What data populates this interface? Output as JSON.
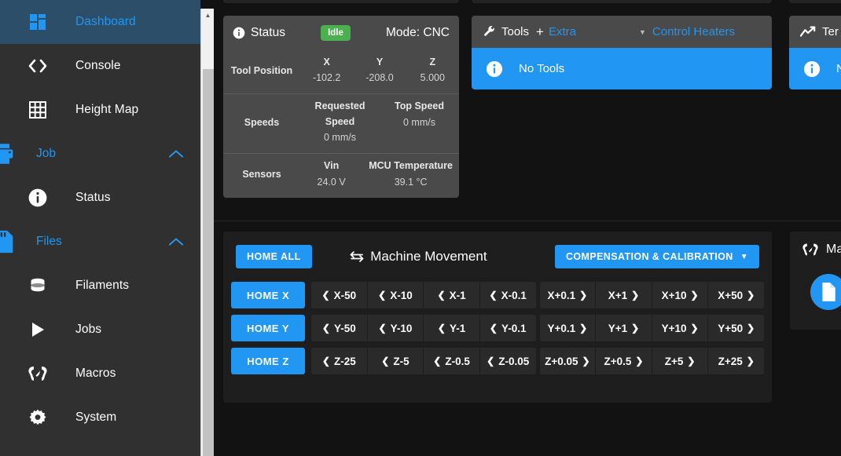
{
  "sidebar": {
    "items": [
      {
        "label": "Dashboard",
        "icon": "dashboard-icon",
        "active": true
      },
      {
        "label": "Console",
        "icon": "code-icon",
        "active": false
      },
      {
        "label": "Height Map",
        "icon": "grid-icon",
        "active": false
      }
    ],
    "groups": [
      {
        "label": "Job",
        "icon": "printer-icon",
        "expanded": true,
        "items": [
          {
            "label": "Status",
            "icon": "info-icon"
          }
        ]
      },
      {
        "label": "Files",
        "icon": "sdcard-icon",
        "expanded": true,
        "items": [
          {
            "label": "Filaments",
            "icon": "database-icon"
          },
          {
            "label": "Jobs",
            "icon": "play-icon"
          },
          {
            "label": "Macros",
            "icon": "macro-icon"
          },
          {
            "label": "System",
            "icon": "gear-icon"
          }
        ]
      }
    ]
  },
  "status_card": {
    "icon": "info-icon",
    "title": "Status",
    "badge": "Idle",
    "badge_color": "#4caf50",
    "mode": "Mode: CNC",
    "sections": [
      {
        "label": "Tool Position",
        "cells": [
          {
            "k": "X",
            "v": "-102.2"
          },
          {
            "k": "Y",
            "v": "-208.0"
          },
          {
            "k": "Z",
            "v": "5.000"
          }
        ]
      },
      {
        "label": "Speeds",
        "cells": [
          {
            "k": "Requested Speed",
            "v": "0 mm/s"
          },
          {
            "k": "Top Speed",
            "v": "0 mm/s"
          }
        ]
      },
      {
        "label": "Sensors",
        "cells": [
          {
            "k": "Vin",
            "v": "24.0 V"
          },
          {
            "k": "MCU Temperature",
            "v": "39.1 °C"
          }
        ]
      }
    ]
  },
  "tools_card": {
    "icon": "wrench-icon",
    "title": "Tools",
    "plus": "+",
    "extra": "Extra",
    "caret": "caret-down-icon",
    "control_heaters": "Control Heaters",
    "empty_icon": "info-icon",
    "empty_text": "No Tools"
  },
  "temp_card": {
    "icon": "chart-line-icon",
    "title": "Ter",
    "empty_icon": "info-icon",
    "empty_text": "N"
  },
  "movement_card": {
    "home_all": "HOME ALL",
    "title": "Machine Movement",
    "title_icon": "move-arrows-icon",
    "compensation": "COMPENSATION & CALIBRATION",
    "compensation_caret": "caret-down-icon",
    "axes": [
      {
        "home": "HOME X",
        "neg": [
          "X-50",
          "X-10",
          "X-1",
          "X-0.1"
        ],
        "pos": [
          "X+0.1",
          "X+1",
          "X+10",
          "X+50"
        ]
      },
      {
        "home": "HOME Y",
        "neg": [
          "Y-50",
          "Y-10",
          "Y-1",
          "Y-0.1"
        ],
        "pos": [
          "Y+0.1",
          "Y+1",
          "Y+10",
          "Y+50"
        ]
      },
      {
        "home": "HOME Z",
        "neg": [
          "Z-25",
          "Z-5",
          "Z-0.5",
          "Z-0.05"
        ],
        "pos": [
          "Z+0.05",
          "Z+0.5",
          "Z+5",
          "Z+25"
        ]
      }
    ]
  },
  "macros_card": {
    "icon": "macro-icon",
    "title": "Mac",
    "fab_icon": "file-icon"
  },
  "scrollbar": {
    "arrow_icon": "triangle-up-icon"
  },
  "colors": {
    "accent": "#2196f3",
    "sidebar_bg": "#303030",
    "active_bg": "#2d4e68",
    "card_bg": "#1e1e1e",
    "card_header_bg": "#4a4a4a",
    "page_bg": "#121212",
    "status_ok": "#4caf50"
  }
}
